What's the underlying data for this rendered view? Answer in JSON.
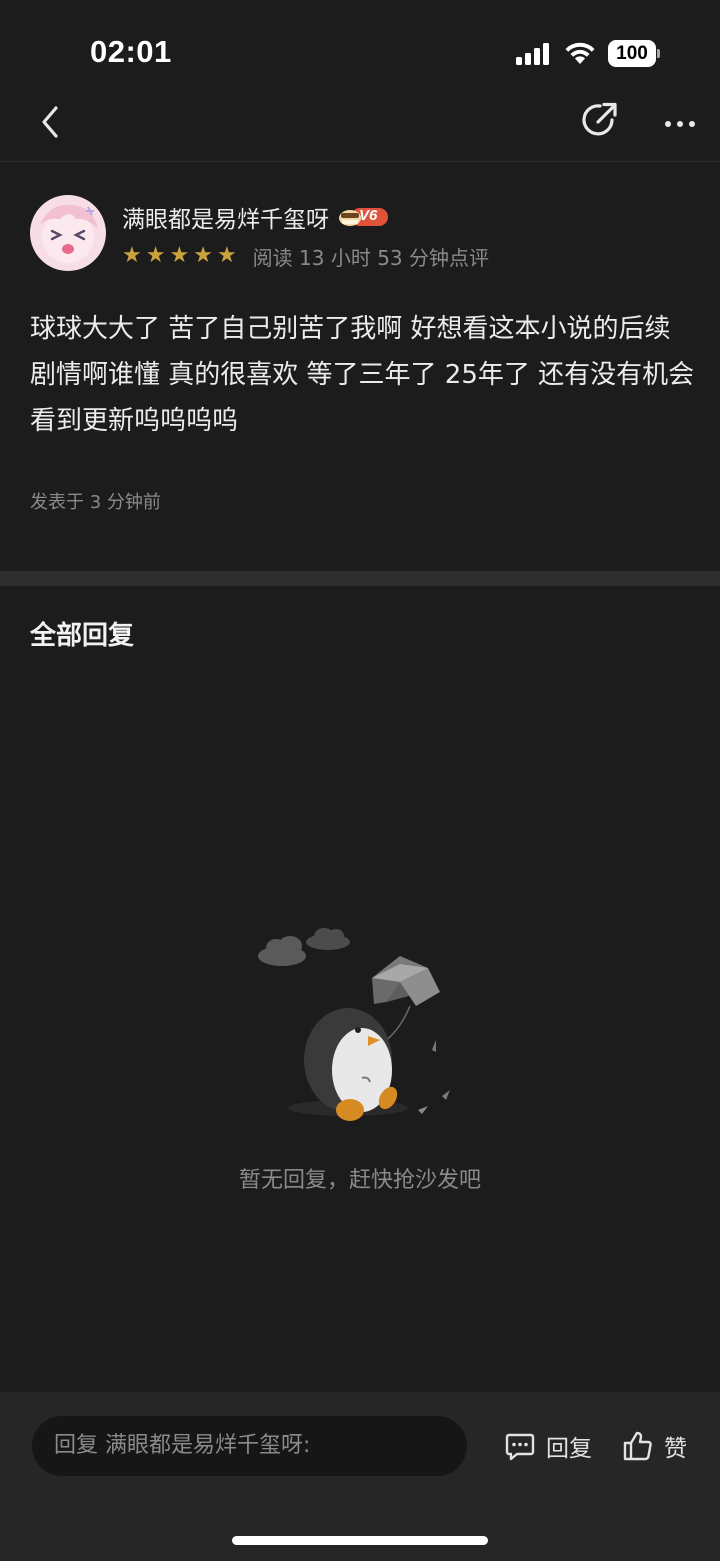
{
  "status_bar": {
    "time": "02:01",
    "battery": "100"
  },
  "nav": {
    "back_icon": "chevron-left-icon",
    "share_icon": "share-icon",
    "more_icon": "more-icon"
  },
  "comment": {
    "username": "满眼都是易烊千玺呀",
    "vip_level": "V6",
    "rating": 5,
    "read_info": "阅读 13 小时 53 分钟点评",
    "text": "球球大大了 苦了自己别苦了我啊 好想看这本小说的后续剧情啊谁懂 真的很喜欢 等了三年了 25年了 还有没有机会看到更新呜呜呜呜",
    "post_time": "发表于 3 分钟前"
  },
  "replies": {
    "title": "全部回复",
    "empty_text": "暂无回复，赶快抢沙发吧"
  },
  "bottom_bar": {
    "input_placeholder": "回复 满眼都是易烊千玺呀:",
    "reply_label": "回复",
    "like_label": "赞"
  },
  "colors": {
    "background": "#1c1c1c",
    "star": "#c9a23e",
    "vip_badge": "#e0533a"
  }
}
